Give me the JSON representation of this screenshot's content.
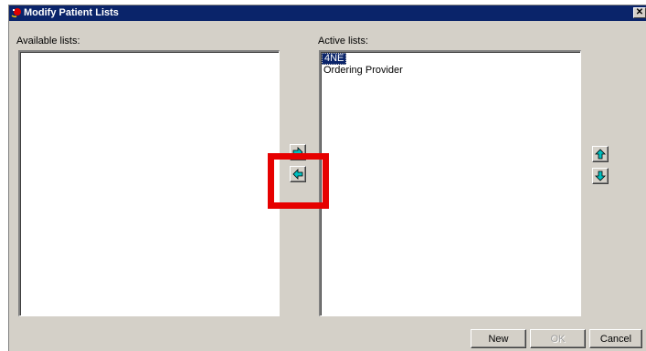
{
  "window": {
    "title": "Modify Patient Lists",
    "close_glyph": "✕"
  },
  "available": {
    "label": "Available lists:",
    "items": []
  },
  "active": {
    "label": "Active lists:",
    "items": [
      "4NE",
      "Ordering Provider"
    ],
    "selected": "4NE"
  },
  "buttons": {
    "new": "New",
    "ok": "OK",
    "cancel": "Cancel",
    "ok_enabled": false
  },
  "icons": {
    "move_right": "arrow-right-icon",
    "move_left": "arrow-left-icon",
    "move_up": "arrow-up-icon",
    "move_down": "arrow-down-icon"
  },
  "colors": {
    "titlebar": "#0a246a",
    "highlight": "#e60000",
    "arrow_fill": "#00c0c0",
    "dialog": "#d4d0c8"
  }
}
